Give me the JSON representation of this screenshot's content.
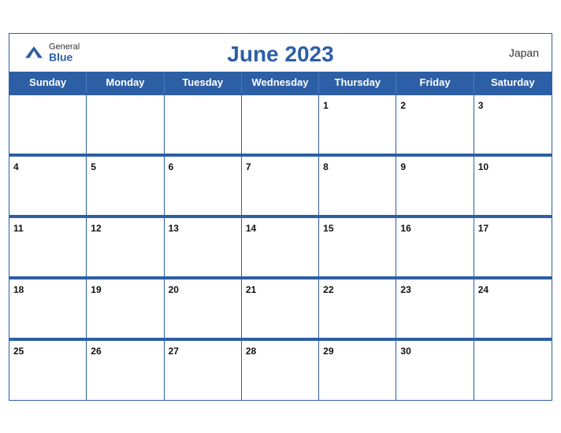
{
  "header": {
    "logo_general": "General",
    "logo_blue": "Blue",
    "title": "June 2023",
    "country": "Japan"
  },
  "days": [
    "Sunday",
    "Monday",
    "Tuesday",
    "Wednesday",
    "Thursday",
    "Friday",
    "Saturday"
  ],
  "weeks": [
    [
      null,
      null,
      null,
      null,
      1,
      2,
      3
    ],
    [
      4,
      5,
      6,
      7,
      8,
      9,
      10
    ],
    [
      11,
      12,
      13,
      14,
      15,
      16,
      17
    ],
    [
      18,
      19,
      20,
      21,
      22,
      23,
      24
    ],
    [
      25,
      26,
      27,
      28,
      29,
      30,
      null
    ]
  ],
  "colors": {
    "blue": "#2d5fa6",
    "header_text": "#fff",
    "day_num": "#111"
  }
}
